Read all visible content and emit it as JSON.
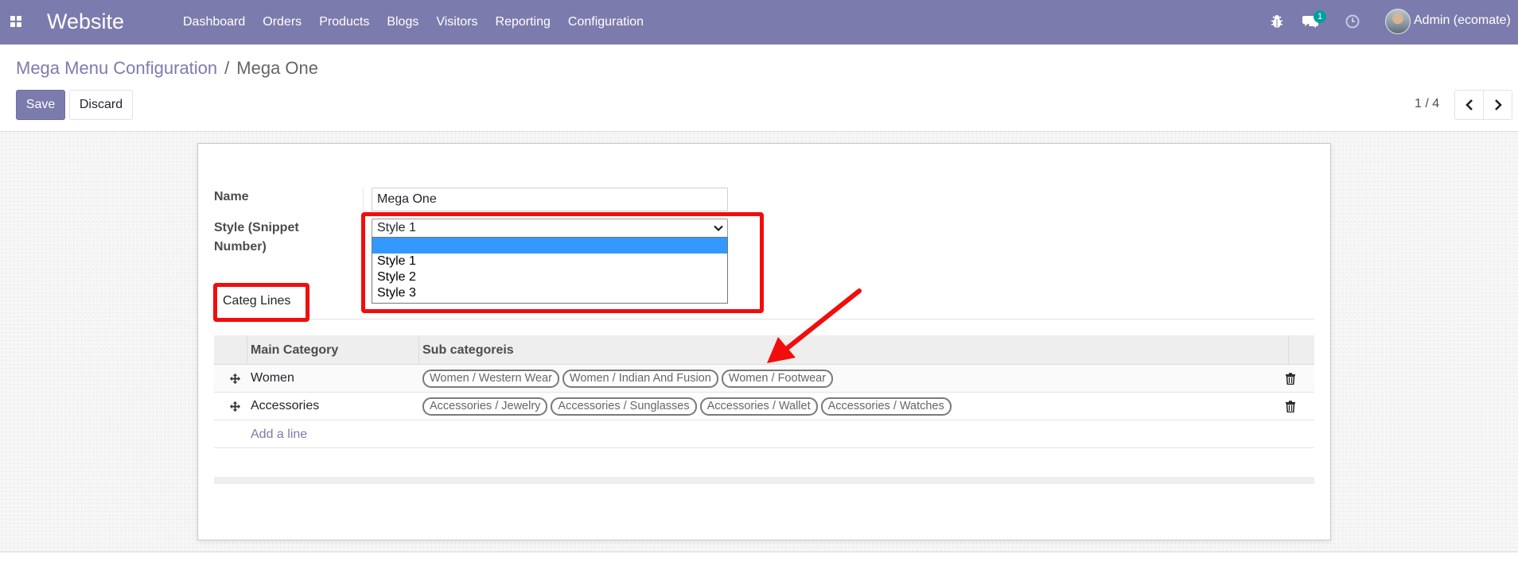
{
  "app": {
    "name": "Website",
    "menu": [
      "Dashboard",
      "Orders",
      "Products",
      "Blogs",
      "Visitors",
      "Reporting",
      "Configuration"
    ],
    "chat_badge": "1",
    "user": "Admin (ecomate)",
    "brand_color": "#7c7bad"
  },
  "breadcrumb": {
    "parent": "Mega Menu Configuration",
    "separator": "/",
    "current": "Mega One"
  },
  "actions": {
    "save": "Save",
    "discard": "Discard"
  },
  "pager": {
    "value": "1 / 4"
  },
  "form": {
    "name_label": "Name",
    "name_value": "Mega One",
    "style_label": "Style (Snippet Number)",
    "style_value": "Style 1",
    "style_options": [
      "",
      "Style 1",
      "Style 2",
      "Style 3"
    ]
  },
  "tab": {
    "label": "Categ Lines"
  },
  "table": {
    "headers": {
      "main": "Main Category",
      "sub": "Sub categoreis"
    },
    "rows": [
      {
        "main": "Women",
        "tags": [
          "Women / Western Wear",
          "Women / Indian And Fusion",
          "Women / Footwear"
        ]
      },
      {
        "main": "Accessories",
        "tags": [
          "Accessories / Jewelry",
          "Accessories / Sunglasses",
          "Accessories / Wallet",
          "Accessories / Watches"
        ]
      }
    ],
    "add_line": "Add a line"
  },
  "annotation_color": "#f20d0d"
}
